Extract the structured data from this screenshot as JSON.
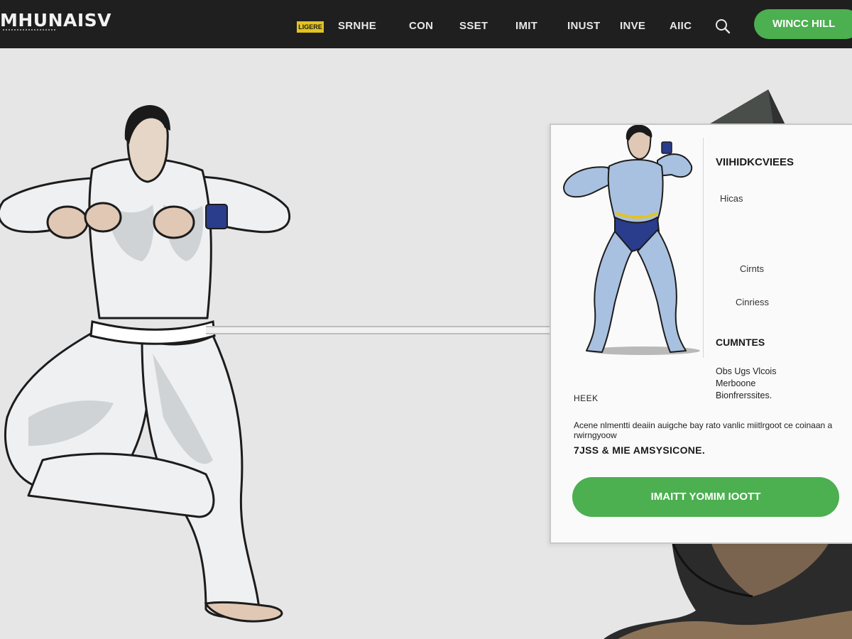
{
  "header": {
    "logo": "MHUNAISV",
    "badge": "LIGERE",
    "nav": [
      "SRNHE",
      "CON",
      "SSET",
      "IMIT",
      "INUST",
      "INVE",
      "AIIC"
    ],
    "search_icon": "search-icon",
    "cta": "WINCC HILL"
  },
  "card": {
    "title": "VIIHIDKCVIEES",
    "tags": [
      "Hicas",
      "Cirnts",
      "Cinriess"
    ],
    "section_title": "CUMNTES",
    "details": [
      "Obs Ugs Vlcois",
      "Merboone",
      "Bionfrerssites."
    ],
    "label": "HEEK",
    "description": "Acene nlmentti deaiin auigche bay rato vanlic miitlrgoot ce coinaan a rwirngyoow",
    "stats": "7JSS & MIE AMSYSICONE.",
    "cta": "IMAITT YOMIM IOOTT"
  },
  "colors": {
    "nav_bg": "#1f1f1f",
    "accent_green": "#4caf50",
    "badge_yellow": "#e3c321",
    "page_bg": "#e6e6e6"
  }
}
